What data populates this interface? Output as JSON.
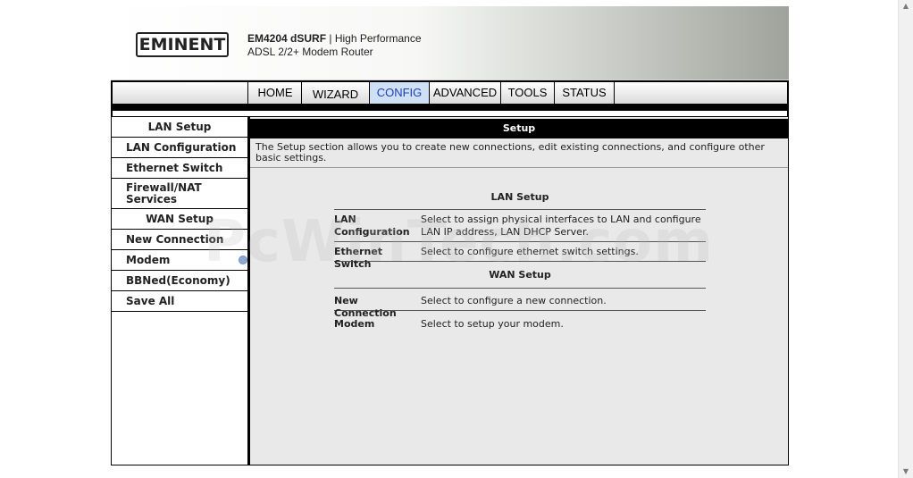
{
  "header": {
    "logo_text": "EMINENT",
    "product_line1_bold": "EM4204 dSURF",
    "product_line1_rest": " | High Performance",
    "product_line2": "ADSL 2/2+ Modem Router"
  },
  "nav": {
    "tabs": [
      {
        "label": "HOME"
      },
      {
        "label": "WIZARD"
      },
      {
        "label": "CONFIG",
        "active": true
      },
      {
        "label": "ADVANCED"
      },
      {
        "label": "TOOLS"
      },
      {
        "label": "STATUS"
      }
    ]
  },
  "sidebar": {
    "items": [
      {
        "label": "LAN Setup",
        "type": "heading"
      },
      {
        "label": "LAN Configuration"
      },
      {
        "label": "Ethernet Switch"
      },
      {
        "label": "Firewall/NAT Services"
      },
      {
        "label": "WAN Setup",
        "type": "heading"
      },
      {
        "label": "New Connection"
      },
      {
        "label": "Modem",
        "indicator_icon": "circle-icon"
      },
      {
        "label": "BBNed(Economy)"
      },
      {
        "label": "Save All"
      }
    ]
  },
  "main": {
    "title": "Setup",
    "intro": "The Setup section allows you to create new connections, edit existing connections, and configure other basic settings.",
    "lan_section": {
      "heading": "LAN Setup",
      "rows": [
        {
          "label": "LAN Configuration",
          "desc": "Select to assign physical interfaces to LAN and configure LAN IP address, LAN DHCP Server."
        },
        {
          "label": "Ethernet Switch",
          "desc": "Select to configure ethernet switch settings."
        }
      ]
    },
    "wan_section": {
      "heading": "WAN Setup",
      "rows": [
        {
          "label": "New Connection",
          "desc": "Select to configure a new connection."
        },
        {
          "label": "Modem",
          "desc": "Select to setup your modem."
        }
      ]
    }
  },
  "watermark": "PcWinTech.com",
  "colors": {
    "active_tab_bg": "#cfe0f5",
    "active_tab_text": "#1a3fb8",
    "title_bar": "#000000",
    "content_bg": "#e9e9e9"
  }
}
